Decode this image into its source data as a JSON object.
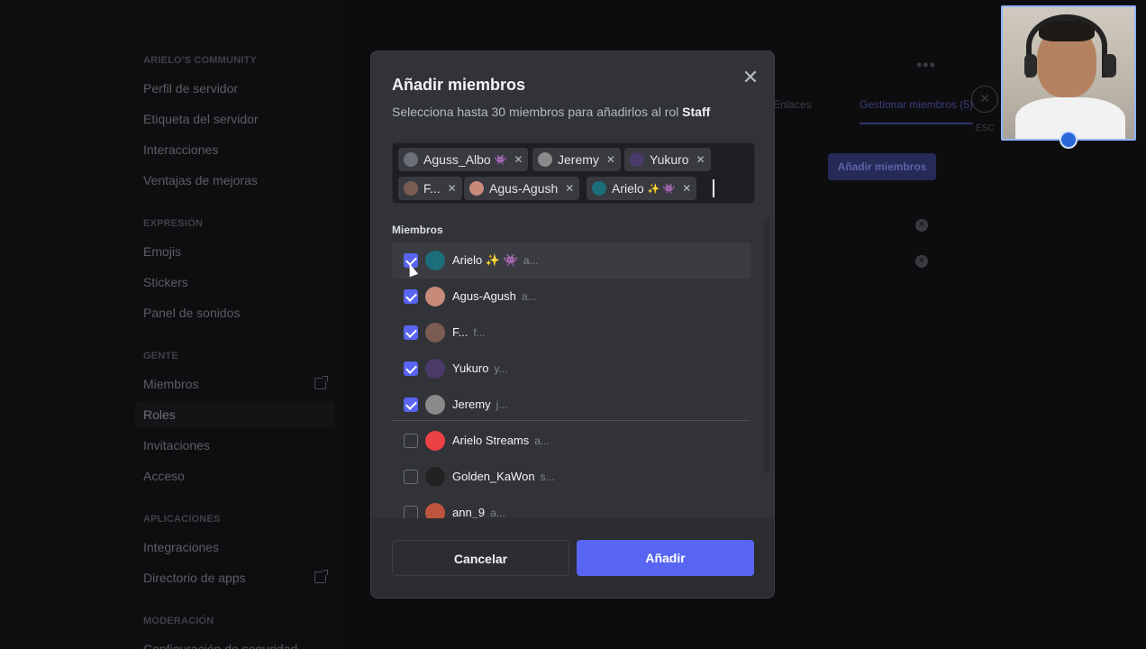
{
  "sidebar": {
    "sections": [
      {
        "header": "ARIELO'S COMMUNITY",
        "items": [
          "Perfil de servidor",
          "Etiqueta del servidor",
          "Interacciones",
          "Ventajas de mejoras"
        ]
      },
      {
        "header": "EXPRESIÓN",
        "items": [
          "Emojis",
          "Stickers",
          "Panel de sonidos"
        ]
      },
      {
        "header": "GENTE",
        "items": [
          "Miembros",
          "Roles",
          "Invitaciones",
          "Acceso"
        ]
      },
      {
        "header": "APLICACIONES",
        "items": [
          "Integraciones",
          "Directorio de apps"
        ]
      },
      {
        "header": "MODERACIÓN",
        "items": [
          "Configuración de seguridad"
        ]
      }
    ],
    "active_item": "Roles"
  },
  "background": {
    "tab_links": "Enlaces",
    "tab_manage": "Gestionar miembros (5)",
    "add_members_button": "Añadir miembros",
    "esc_label": "ESC"
  },
  "modal": {
    "title": "Añadir miembros",
    "subtitle_prefix": "Selecciona hasta 30 miembros para añadirlos al rol ",
    "role_name": "Staff",
    "chips": [
      {
        "label": "Aguss_Albo",
        "emoji": "👾"
      },
      {
        "label": "Jeremy",
        "emoji": ""
      },
      {
        "label": "Yukuro",
        "emoji": ""
      },
      {
        "label": "F...",
        "emoji": ""
      },
      {
        "label": "Agus-Agush",
        "emoji": ""
      },
      {
        "label": "Arielo",
        "emoji": "✨ 👾"
      }
    ],
    "list_header": "Miembros",
    "members": [
      {
        "name": "Arielo ✨ 👾",
        "username": "a...",
        "checked": true,
        "avatar_color": "#1c6e7a"
      },
      {
        "name": "Agus-Agush",
        "username": "a...",
        "checked": true,
        "avatar_color": "#c98a7a"
      },
      {
        "name": "F...",
        "username": "f...",
        "checked": true,
        "avatar_color": "#7a5c54"
      },
      {
        "name": "Yukuro",
        "username": "y...",
        "checked": true,
        "avatar_color": "#4a3a6a"
      },
      {
        "name": "Jeremy",
        "username": "j...",
        "checked": true,
        "avatar_color": "#8a8a8a"
      },
      {
        "name": "Arielo Streams",
        "username": "a...",
        "checked": false,
        "avatar_color": "#ed4245"
      },
      {
        "name": "Golden_KaWon",
        "username": "s...",
        "checked": false,
        "avatar_color": "#222222"
      },
      {
        "name": "ann_9",
        "username": "a...",
        "checked": false,
        "avatar_color": "#c0553f"
      }
    ],
    "cancel_label": "Cancelar",
    "add_label": "Añadir"
  }
}
